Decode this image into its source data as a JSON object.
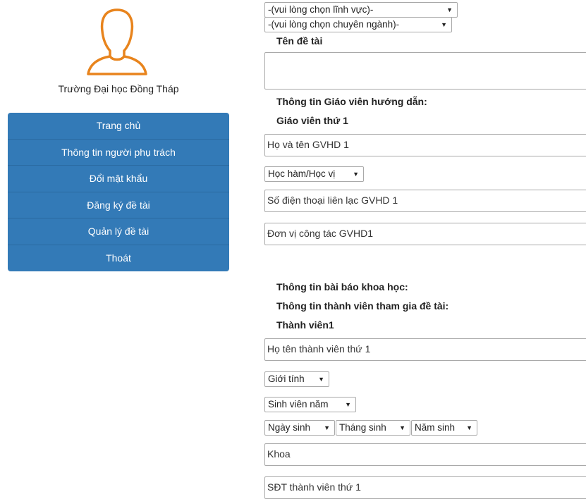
{
  "sidebar": {
    "school_name": "Trường Đại học Đồng Tháp",
    "menu": [
      {
        "label": "Trang chủ"
      },
      {
        "label": "Thông tin người phụ trách"
      },
      {
        "label": "Đổi mật khẩu"
      },
      {
        "label": "Đăng ký đề tài"
      },
      {
        "label": "Quản lý đề tài"
      },
      {
        "label": "Thoát"
      }
    ]
  },
  "form": {
    "field_select": "-(vui lòng chọn lĩnh vực)-",
    "major_select": "-(vui lòng chọn chuyên ngành)-",
    "topic_title_label": "Tên đề tài",
    "advisor_section_label": "Thông tin Giáo viên hướng dẫn:",
    "advisor1_label": "Giáo viên thứ 1",
    "advisor1_name_placeholder": "Họ và tên GVHD 1",
    "academic_title_select": "Học hàm/Học vị",
    "advisor1_phone_placeholder": "Số điện thoại liên lạc GVHD 1",
    "advisor1_unit_placeholder": "Đơn vị công tác GVHD1",
    "article_section_label": "Thông tin bài báo khoa học:",
    "members_section_label": "Thông tin thành viên tham gia đề tài:",
    "member1_label": "Thành viên1",
    "member1_name_placeholder": "Họ tên thành viên thứ 1",
    "gender_select": "Giới tính",
    "year_select": "Sinh viên năm",
    "birth_day_select": "Ngày sinh",
    "birth_month_select": "Tháng sinh",
    "birth_year_select": "Năm sinh",
    "faculty_placeholder": "Khoa",
    "member1_phone_placeholder": "SĐT thành viên thứ 1"
  },
  "colors": {
    "avatar": "#e8841d",
    "menu_bg": "#337ab7"
  }
}
